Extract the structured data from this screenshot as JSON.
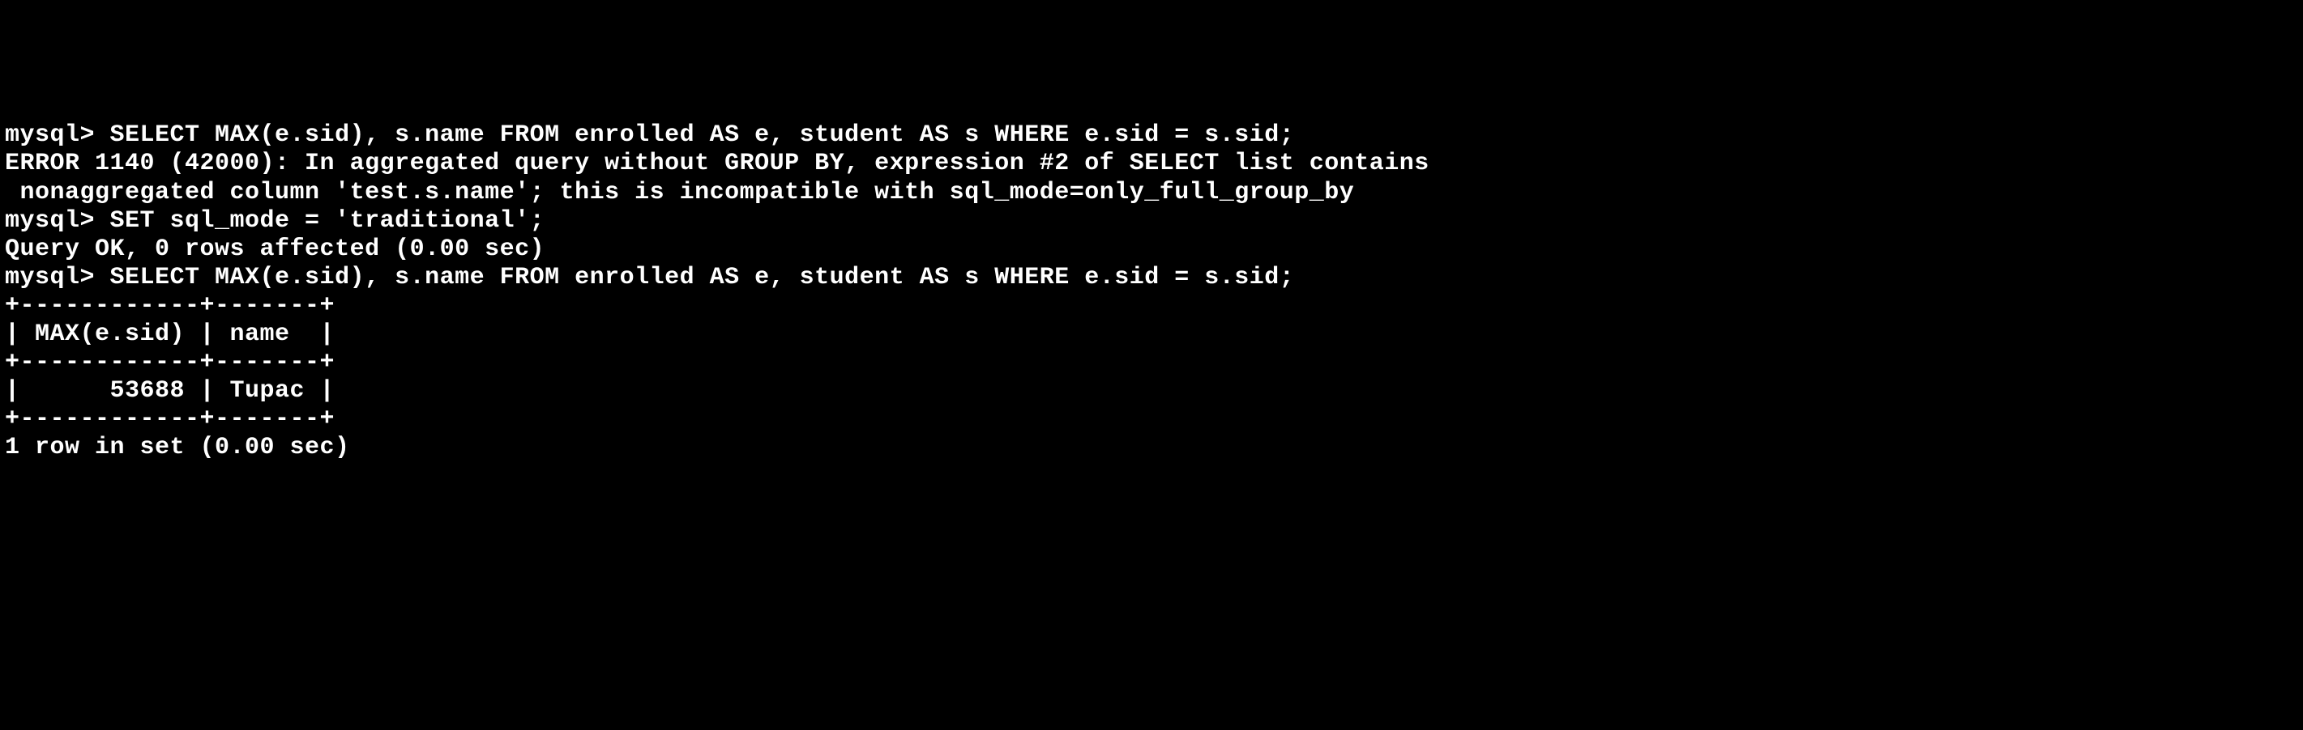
{
  "terminal": {
    "lines": [
      "mysql> SELECT MAX(e.sid), s.name FROM enrolled AS e, student AS s WHERE e.sid = s.sid;",
      "ERROR 1140 (42000): In aggregated query without GROUP BY, expression #2 of SELECT list contains",
      " nonaggregated column 'test.s.name'; this is incompatible with sql_mode=only_full_group_by",
      "mysql> SET sql_mode = 'traditional';",
      "Query OK, 0 rows affected (0.00 sec)",
      "",
      "mysql> SELECT MAX(e.sid), s.name FROM enrolled AS e, student AS s WHERE e.sid = s.sid;",
      "+------------+-------+",
      "| MAX(e.sid) | name  |",
      "+------------+-------+",
      "|      53688 | Tupac |",
      "+------------+-------+",
      "1 row in set (0.00 sec)"
    ]
  },
  "session": {
    "prompt": "mysql>",
    "queries": [
      {
        "sql": "SELECT MAX(e.sid), s.name FROM enrolled AS e, student AS s WHERE e.sid = s.sid;",
        "result_type": "error",
        "error_code": "1140",
        "sql_state": "42000",
        "error_message": "In aggregated query without GROUP BY, expression #2 of SELECT list contains nonaggregated column 'test.s.name'; this is incompatible with sql_mode=only_full_group_by"
      },
      {
        "sql": "SET sql_mode = 'traditional';",
        "result_type": "ok",
        "rows_affected": 0,
        "time_sec": "0.00"
      },
      {
        "sql": "SELECT MAX(e.sid), s.name FROM enrolled AS e, student AS s WHERE e.sid = s.sid;",
        "result_type": "resultset",
        "columns": [
          "MAX(e.sid)",
          "name"
        ],
        "rows": [
          [
            "53688",
            "Tupac"
          ]
        ],
        "row_count": 1,
        "time_sec": "0.00"
      }
    ]
  }
}
